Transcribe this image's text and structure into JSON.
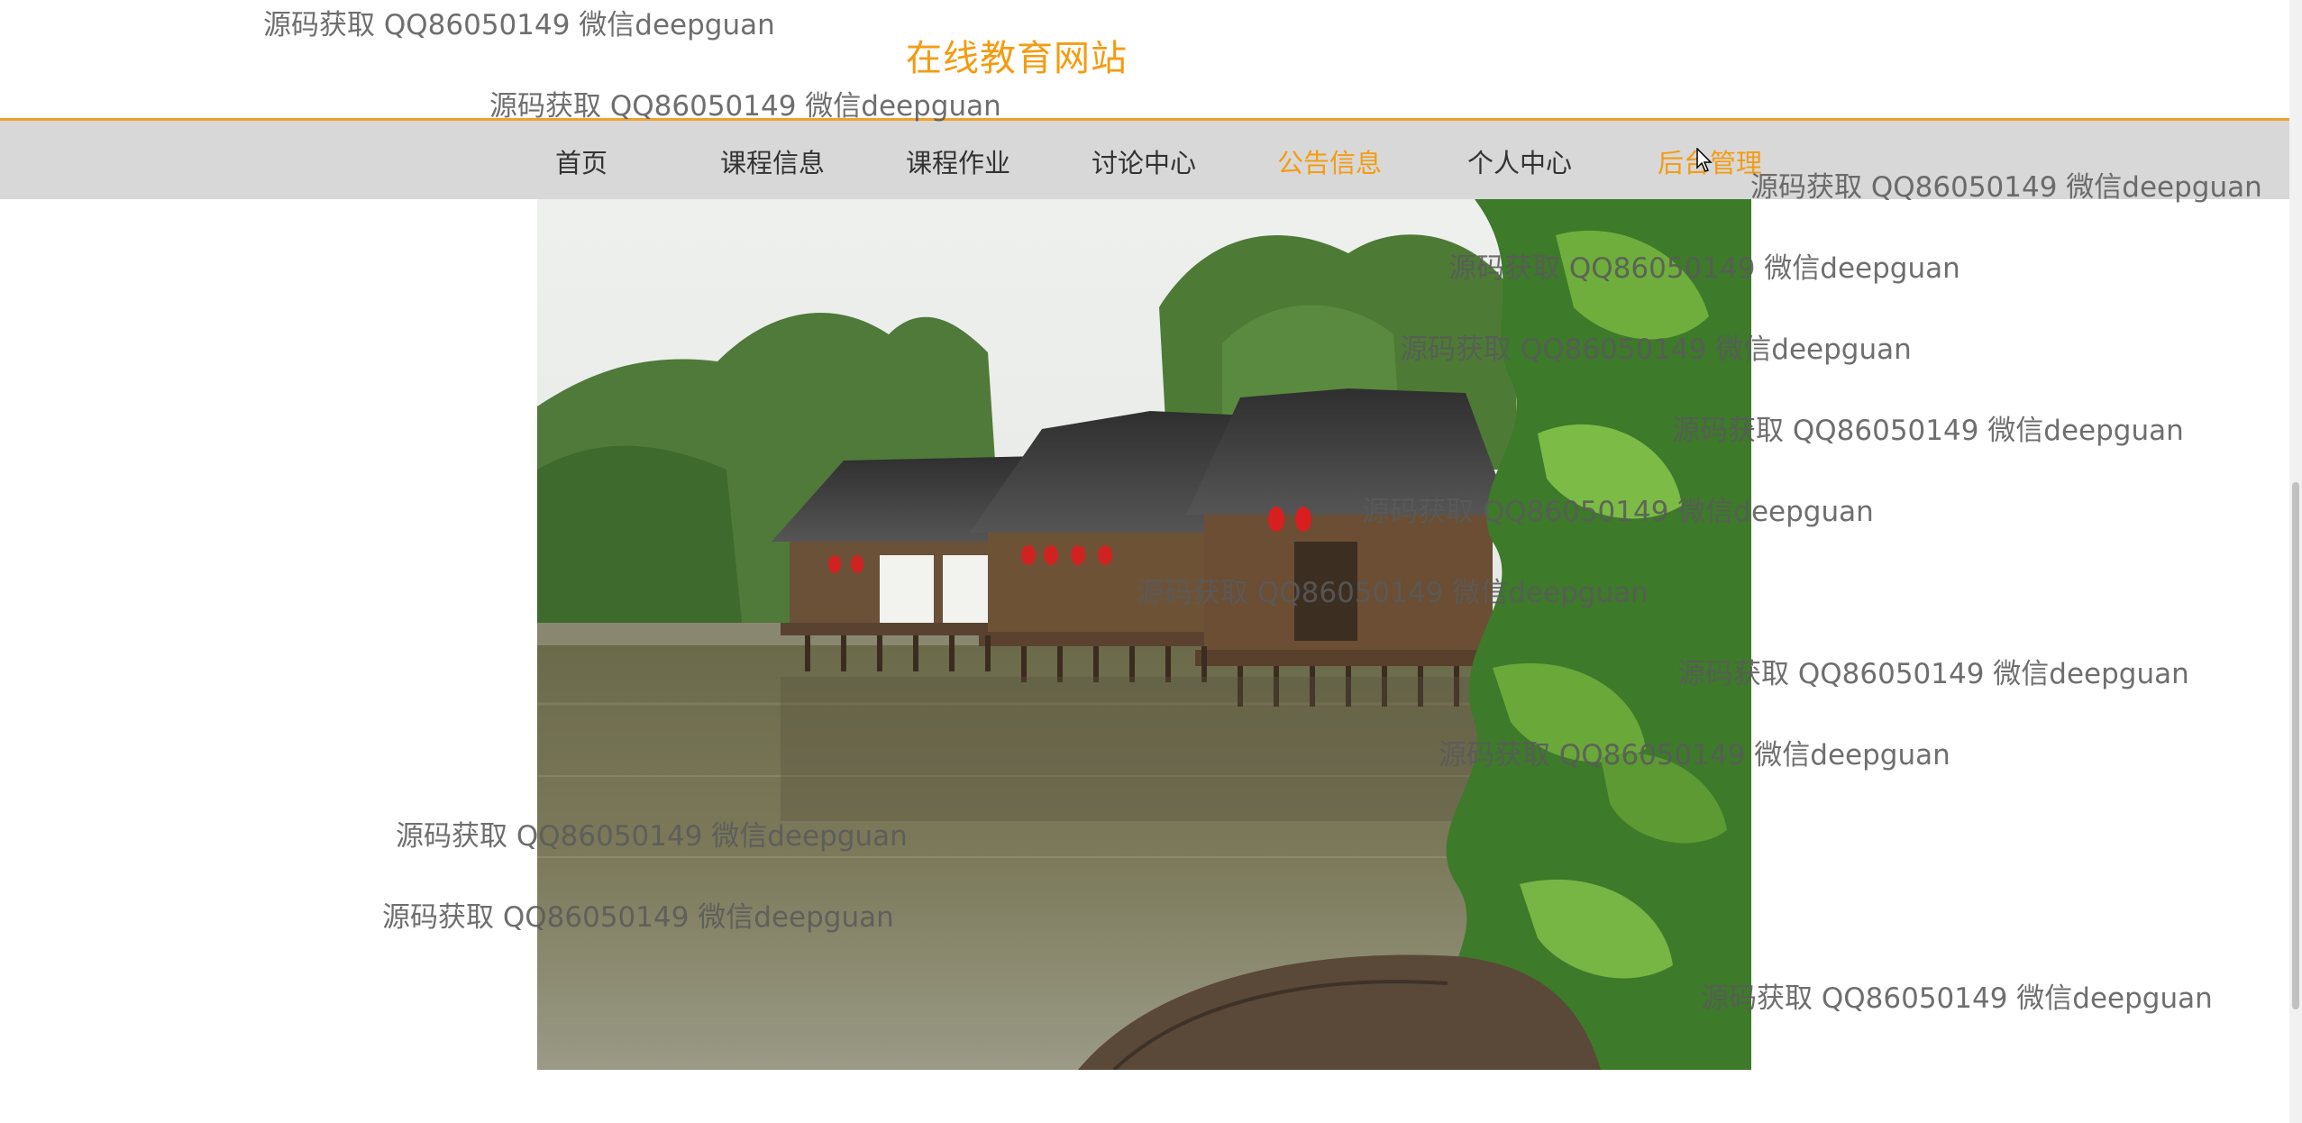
{
  "site": {
    "title": "在线教育网站"
  },
  "nav": {
    "items": [
      {
        "label": "首页"
      },
      {
        "label": "课程信息"
      },
      {
        "label": "课程作业"
      },
      {
        "label": "讨论中心"
      },
      {
        "label": "公告信息"
      },
      {
        "label": "个人中心"
      },
      {
        "label": "后台管理"
      }
    ],
    "active_index": 4
  },
  "watermark": {
    "text": "源码获取 QQ86050149 微信deepguan",
    "count": 15
  },
  "colors": {
    "accent": "#f39c12",
    "nav_bg": "#d8d8d8",
    "nav_border": "#f0a030",
    "text": "#333333"
  }
}
